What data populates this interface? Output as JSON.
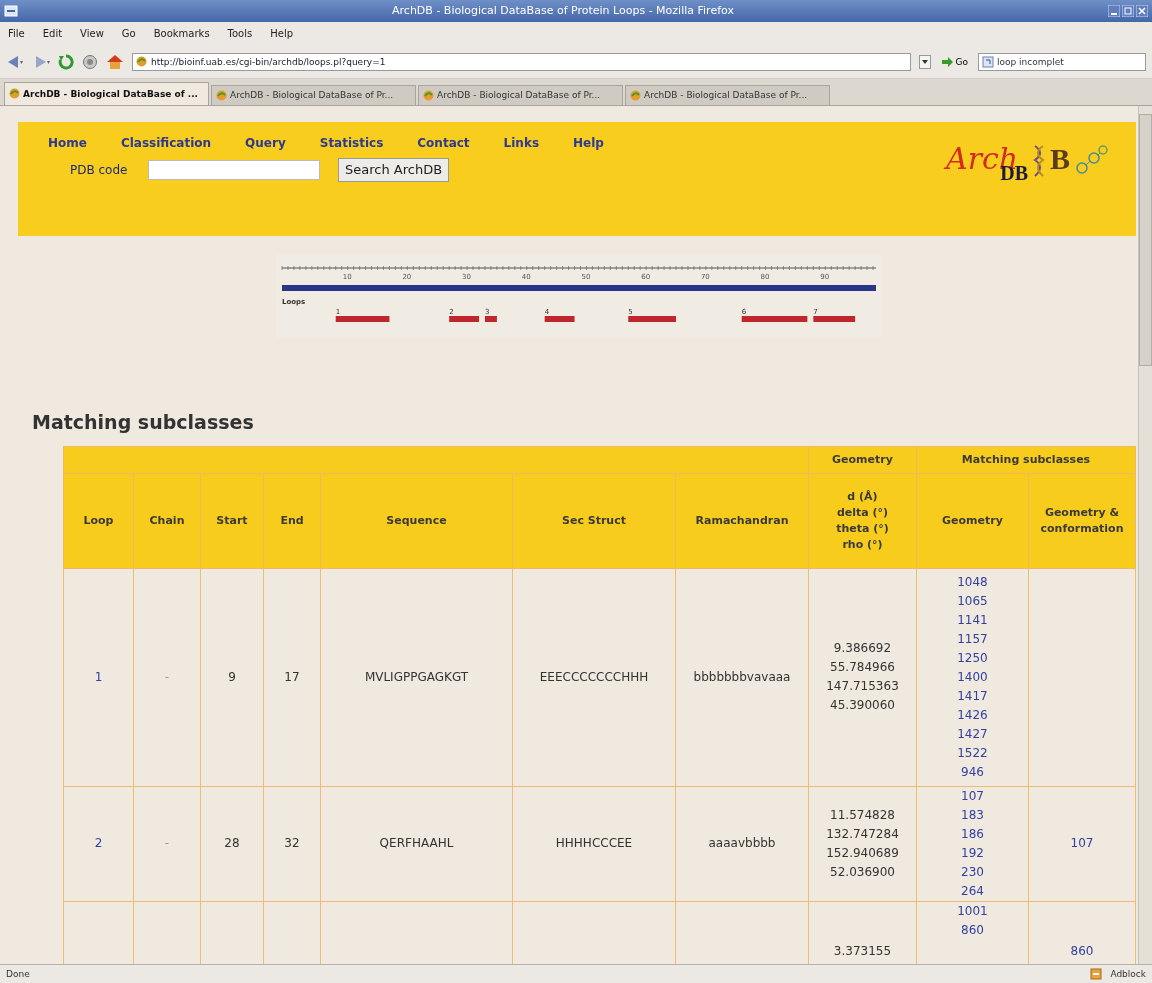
{
  "window": {
    "title": "ArchDB - Biological DataBase of Protein Loops - Mozilla Firefox"
  },
  "menu": [
    "File",
    "Edit",
    "View",
    "Go",
    "Bookmarks",
    "Tools",
    "Help"
  ],
  "navbar": {
    "url": "http://bioinf.uab.es/cgi-bin/archdb/loops.pl?query=1",
    "go": "Go",
    "search_value": "loop incomplet"
  },
  "tabs": [
    {
      "label": "ArchDB - Biological DataBase of ...",
      "selected": true
    },
    {
      "label": "ArchDB - Biological DataBase of Pr...",
      "selected": false
    },
    {
      "label": "ArchDB - Biological DataBase of Pr...",
      "selected": false
    },
    {
      "label": "ArchDB - Biological DataBase of Pr...",
      "selected": false
    }
  ],
  "header": {
    "links": [
      "Home",
      "Classification",
      "Query",
      "Statistics",
      "Contact",
      "Links",
      "Help"
    ],
    "pdb_label": "PDB code",
    "button": "Search ArchDB",
    "logo": {
      "word": "Arch",
      "sub": "DB",
      "side": "B"
    }
  },
  "loop_map": {
    "ticks": [
      "10",
      "20",
      "30",
      "40",
      "50",
      "60",
      "70",
      "80",
      "90"
    ],
    "legend": "Loops",
    "loops": [
      "1",
      "2",
      "3",
      "4",
      "5",
      "6",
      "7"
    ]
  },
  "heading": "Matching subclasses",
  "table": {
    "group_headers": [
      "Geometry",
      "Matching subclasses"
    ],
    "columns": [
      "Loop",
      "Chain",
      "Start",
      "End",
      "Sequence",
      "Sec Struct",
      "Ramachandran"
    ],
    "geometry_header": [
      "d (Å)",
      "delta (°)",
      "theta (°)",
      "rho (°)"
    ],
    "subclass_columns": [
      "Geometry",
      "Geometry & conformation"
    ],
    "rows": [
      {
        "loop": "1",
        "chain": "-",
        "start": "9",
        "end": "17",
        "sequence": "MVLIGPPGAGKGT",
        "sec_struct": "EEECCCCCCCHHH",
        "ramachandran": "bbbbbbbvavaaa",
        "geometry": [
          "9.386692",
          "55.784966",
          "147.715363",
          "45.390060"
        ],
        "geometry_matches": [
          "1048",
          "1065",
          "1141",
          "1157",
          "1250",
          "1400",
          "1417",
          "1426",
          "1427",
          "1522",
          "946"
        ]
      },
      {
        "loop": "2",
        "chain": "-",
        "start": "28",
        "end": "32",
        "sequence": "QERFHAAHL",
        "sec_struct": "HHHHCCCEE",
        "ramachandran": "aaaavbbbb",
        "geometry": [
          "11.574828",
          "132.747284",
          "152.940689",
          "52.036900"
        ],
        "geometry_matches": [
          "107",
          "183",
          "186",
          "192",
          "230",
          "264"
        ],
        "conformation_matches": [
          "107"
        ]
      },
      {
        "geometry": [
          "3.373155"
        ],
        "geometry_matches": [
          "1001",
          "860"
        ],
        "conformation_matches": [
          "860"
        ]
      }
    ]
  },
  "status_bar": {
    "text": "Done",
    "addon": "Adblock"
  }
}
